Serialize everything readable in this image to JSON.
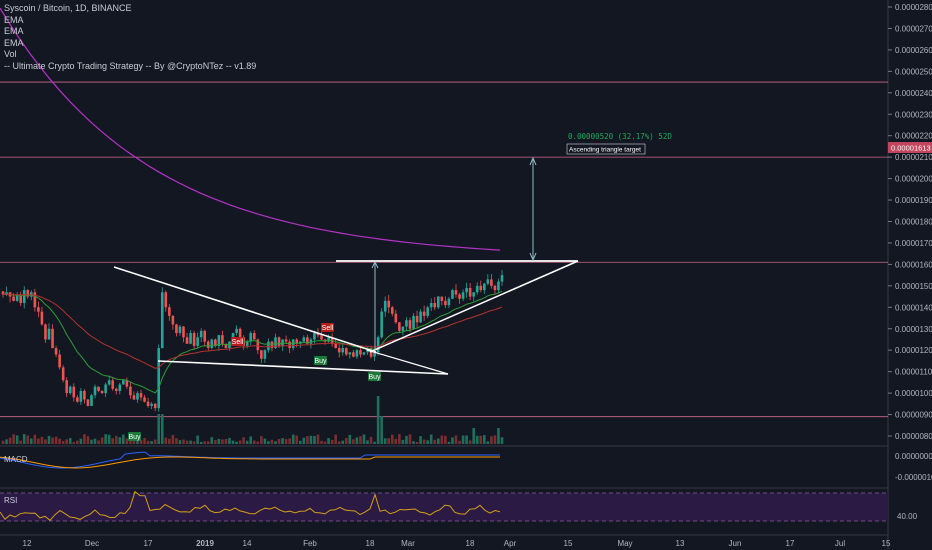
{
  "legend": {
    "symbol": "Syscoin / Bitcoin, 1D, BINANCE",
    "ind1": "EMA",
    "ind2": "EMA",
    "ind3": "EMA",
    "ind4": "Vol",
    "ind5": "-- Ultimate Crypto Trading Strategy -- By @CryptoNTez -- v1.89"
  },
  "panels": {
    "macd_label": "MACD",
    "rsi_label": "RSI"
  },
  "colors": {
    "background": "#131722",
    "up": "#26a69a",
    "down": "#ef5350",
    "ema_long": "#b532c8",
    "ema_mid": "#b5322c",
    "ema_short": "#2e9e36",
    "hline": "#d06a8a",
    "macd": "#2962ff",
    "signal": "#ff9800",
    "rsi": "#d4a017",
    "rsi_band": "#2a1a44"
  },
  "chart_data": {
    "type": "candlestick",
    "title": "Syscoin / Bitcoin, 1D, BINANCE",
    "y_axis_ticks": [
      "0.00002800",
      "0.00002700",
      "0.00002600",
      "0.00002500",
      "0.00002400",
      "0.00002300",
      "0.00002200",
      "0.00002100",
      "0.00002000",
      "0.00001900",
      "0.00001800",
      "0.00001700",
      "0.00001600",
      "0.00001500",
      "0.00001400",
      "0.00001300",
      "0.00001200",
      "0.00001100",
      "0.00001000",
      "0.00000900",
      "0.00000800"
    ],
    "ylim": [
      7.8e-06,
      2.89e-05
    ],
    "current_price_label": "0.00001613",
    "x_axis_ticks": [
      "12",
      "Dec",
      "17",
      "2019",
      "14",
      "Feb",
      "18",
      "Mar",
      "18",
      "Apr",
      "15",
      "May",
      "13",
      "Jun",
      "17",
      "Jul",
      "15"
    ],
    "horizontal_levels": [
      2.45e-05,
      2.1e-05,
      1.61e-05,
      8.9e-06
    ],
    "annotations": {
      "measure_text": "0.00000520 (32.17%) 52D",
      "target_label": "Ascending triangle target"
    },
    "signals": [
      {
        "label": "Sell",
        "kind": "sell"
      },
      {
        "label": "Sell",
        "kind": "sell"
      },
      {
        "label": "Buy",
        "kind": "buy"
      },
      {
        "label": "Buy",
        "kind": "buy"
      },
      {
        "label": "Buy",
        "kind": "buy"
      }
    ],
    "macd_axis_ticks": [
      "0.00000000",
      "-0.00000100"
    ],
    "rsi_axis_ticks": [
      "40.00"
    ],
    "close_series": [
      1.46e-05,
      1.47e-05,
      1.45e-05,
      1.43e-05,
      1.46e-05,
      1.42e-05,
      1.48e-05,
      1.45e-05,
      1.47e-05,
      1.4e-05,
      1.38e-05,
      1.32e-05,
      1.25e-05,
      1.3e-05,
      1.21e-05,
      1.18e-05,
      1.12e-05,
      1.06e-05,
      1e-05,
      1.03e-05,
      9.8e-06,
      9.6e-06,
      1.01e-05,
      9.7e-06,
      9.4e-06,
      9.9e-06,
      1.03e-05,
      1.01e-05,
      1e-05,
      1.04e-05,
      1.06e-05,
      1.02e-05,
      1.01e-05,
      1.04e-05,
      1.06e-05,
      1.03e-05,
      9.9e-06,
      9.7e-06,
      1e-05,
      9.8e-06,
      9.6e-06,
      9.4e-06,
      9.5e-06,
      9.3e-06,
      1.21e-05,
      1.47e-05,
      1.4e-05,
      1.36e-05,
      1.32e-05,
      1.28e-05,
      1.31e-05,
      1.26e-05,
      1.23e-05,
      1.28e-05,
      1.22e-05,
      1.26e-05,
      1.29e-05,
      1.24e-05,
      1.21e-05,
      1.25e-05,
      1.22e-05,
      1.27e-05,
      1.23e-05,
      1.21e-05,
      1.24e-05,
      1.28e-05,
      1.3e-05,
      1.26e-05,
      1.22e-05,
      1.24e-05,
      1.28e-05,
      1.25e-05,
      1.2e-05,
      1.16e-05,
      1.2e-05,
      1.24e-05,
      1.21e-05,
      1.26e-05,
      1.22e-05,
      1.25e-05,
      1.24e-05,
      1.21e-05,
      1.25e-05,
      1.23e-05,
      1.24e-05,
      1.26e-05,
      1.23e-05,
      1.25e-05,
      1.28e-05,
      1.27e-05,
      1.25e-05,
      1.24e-05,
      1.26e-05,
      1.23e-05,
      1.21e-05,
      1.19e-05,
      1.21e-05,
      1.18e-05,
      1.19e-05,
      1.17e-05,
      1.2e-05,
      1.18e-05,
      1.19e-05,
      1.21e-05,
      1.17e-05,
      1.19e-05,
      1.26e-05,
      1.38e-05,
      1.43e-05,
      1.4e-05,
      1.37e-05,
      1.33e-05,
      1.29e-05,
      1.31e-05,
      1.34e-05,
      1.3e-05,
      1.36e-05,
      1.33e-05,
      1.38e-05,
      1.36e-05,
      1.4e-05,
      1.42e-05,
      1.4e-05,
      1.45e-05,
      1.43e-05,
      1.41e-05,
      1.44e-05,
      1.48e-05,
      1.46e-05,
      1.44e-05,
      1.47e-05,
      1.49e-05,
      1.45e-05,
      1.47e-05,
      1.5e-05,
      1.48e-05,
      1.51e-05,
      1.53e-05,
      1.5e-05,
      1.48e-05,
      1.52e-05,
      1.55e-05
    ]
  }
}
